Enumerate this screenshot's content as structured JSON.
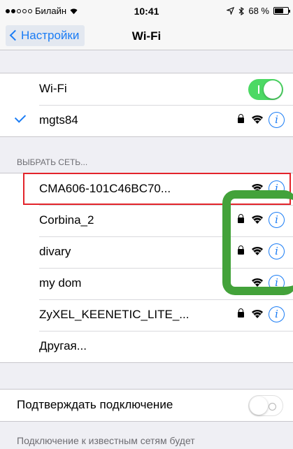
{
  "status_bar": {
    "signal_dots_filled": 2,
    "signal_dots_total": 5,
    "carrier": "Билайн",
    "time": "10:41",
    "battery_percent": "68 %",
    "battery_level": 0.68
  },
  "navbar": {
    "back_label": "Настройки",
    "title": "Wi-Fi"
  },
  "wifi_toggle": {
    "label": "Wi-Fi",
    "on": true
  },
  "connected_network": {
    "name": "mgts84",
    "secured": true
  },
  "section_header": "ВЫБРАТЬ СЕТЬ...",
  "networks": [
    {
      "name": "CMA606-101C46BC70...",
      "secured": false
    },
    {
      "name": "Corbina_2",
      "secured": true
    },
    {
      "name": "divary",
      "secured": true
    },
    {
      "name": "my dom",
      "secured": false
    },
    {
      "name": "ZyXEL_KEENETIC_LITE_...",
      "secured": true
    }
  ],
  "other_label": "Другая...",
  "ask_to_join": {
    "label": "Подтверждать подключение",
    "on": false
  },
  "footer_text": "Подключение к известным сетям будет",
  "colors": {
    "accent": "#1a7cf5",
    "toggle_on": "#4cd964",
    "annotation_red": "#e3242b",
    "annotation_green": "#43a23a"
  },
  "icons": [
    "wifi-icon",
    "lock-icon",
    "info-icon",
    "checkmark-icon",
    "chevron-left-icon",
    "battery-icon",
    "location-icon",
    "bluetooth-icon"
  ]
}
